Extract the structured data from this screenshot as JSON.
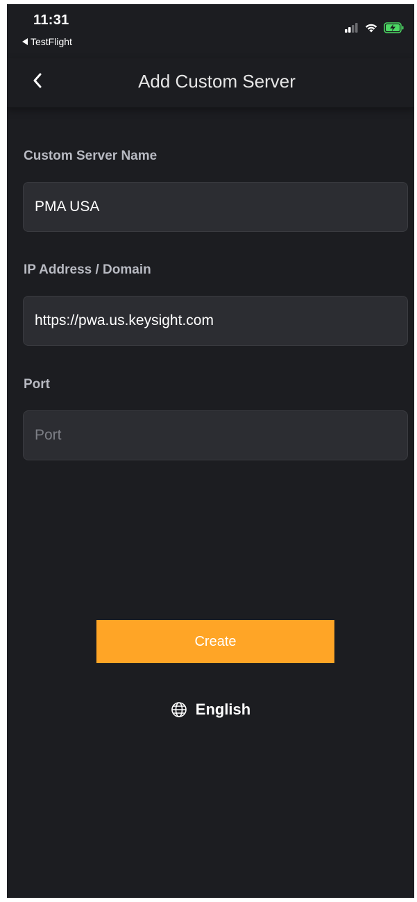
{
  "status_bar": {
    "time": "11:31",
    "back_app": "TestFlight",
    "icons": [
      "signal-icon",
      "wifi-icon",
      "battery-charging-icon"
    ],
    "battery_color": "#4cd964"
  },
  "nav": {
    "title": "Add Custom Server",
    "back_icon": "chevron-left-icon"
  },
  "form": {
    "server_name": {
      "label": "Custom Server Name",
      "value": "PMA USA",
      "placeholder": ""
    },
    "address": {
      "label": "IP Address / Domain",
      "value": "https://pwa.us.keysight.com",
      "placeholder": ""
    },
    "port": {
      "label": "Port",
      "value": "",
      "placeholder": "Port"
    }
  },
  "actions": {
    "create_label": "Create",
    "accent_color": "#ffa526"
  },
  "language": {
    "icon": "globe-icon",
    "label": "English"
  },
  "theme": {
    "background": "#1c1d21",
    "input_background": "#2c2d32"
  }
}
